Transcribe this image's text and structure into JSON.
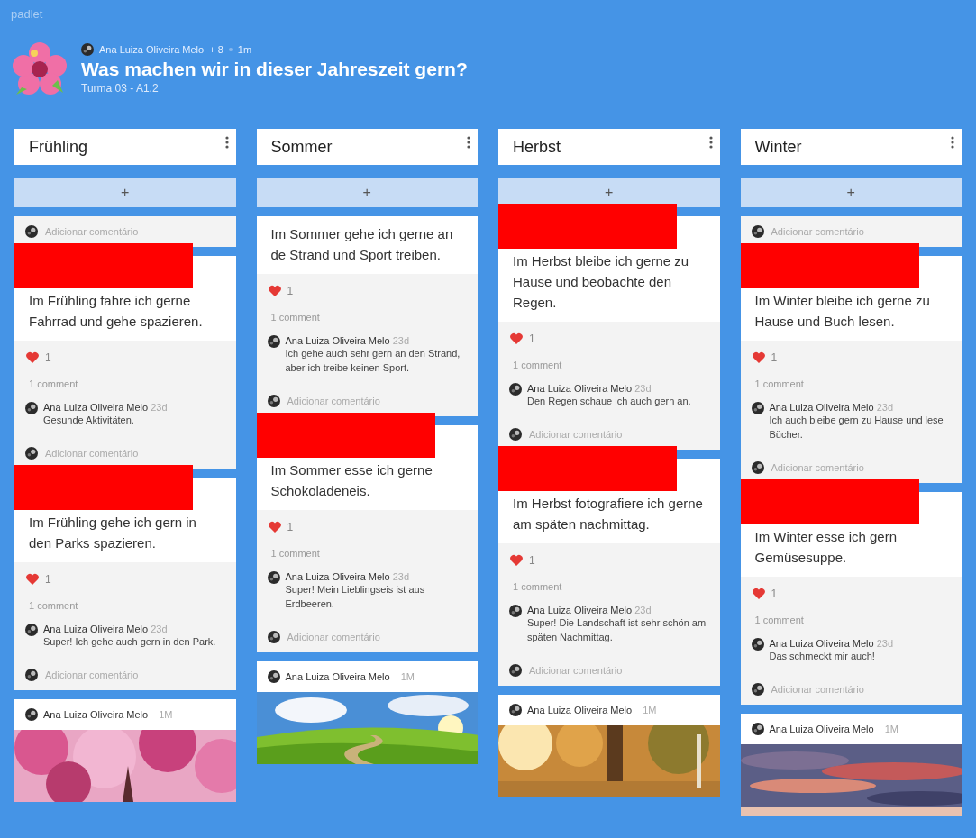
{
  "brand": "padlet",
  "header": {
    "author": "Ana Luiza Oliveira Melo",
    "contributors": "+ 8",
    "time": "1m",
    "title": "Was machen wir in dieser Jahreszeit gern?",
    "subtitle": "Turma 03 - A1.2"
  },
  "add_label": "+",
  "columns": [
    {
      "title": "Frühling",
      "posts": [
        {
          "kind": "tail",
          "add_comment": "Adicionar comentário"
        },
        {
          "kind": "post",
          "redacted": true,
          "text": "Im Frühling fahre ich gerne Fahrrad und gehe spazieren.",
          "likes": "1",
          "comment_count": "1 comment",
          "comments": [
            {
              "author": "Ana Luiza Oliveira Melo",
              "time": "23d",
              "text": "Gesunde Aktivitäten."
            }
          ],
          "add_comment": "Adicionar comentário"
        },
        {
          "kind": "post",
          "redacted": true,
          "text": "Im Frühling gehe ich gern in den Parks spazieren.",
          "likes": "1",
          "comment_count": "1 comment",
          "comments": [
            {
              "author": "Ana Luiza Oliveira Melo",
              "time": "23d",
              "text": "Super! Ich gehe auch gern in den Park."
            }
          ],
          "add_comment": "Adicionar comentário"
        },
        {
          "author": "Ana Luiza Oliveira Melo",
          "time": "1M"
        }
      ]
    },
    {
      "title": "Sommer",
      "posts": [
        {
          "kind": "post",
          "redacted": false,
          "text": "Im Sommer gehe ich gerne an de Strand und Sport treiben.",
          "likes": "1",
          "comment_count": "1 comment",
          "comments": [
            {
              "author": "Ana Luiza Oliveira Melo",
              "time": "23d",
              "text": "Ich gehe auch sehr gern an den Strand, aber ich treibe keinen Sport."
            }
          ],
          "add_comment": "Adicionar comentário"
        },
        {
          "kind": "post",
          "redacted": true,
          "text": "Im Sommer esse ich gerne Schokoladeneis.",
          "likes": "1",
          "comment_count": "1 comment",
          "comments": [
            {
              "author": "Ana Luiza Oliveira Melo",
              "time": "23d",
              "text": "Super! Mein Lieblingseis ist aus Erdbeeren."
            }
          ],
          "add_comment": "Adicionar comentário"
        },
        {
          "author": "Ana Luiza Oliveira Melo",
          "time": "1M"
        }
      ]
    },
    {
      "title": "Herbst",
      "posts": [
        {
          "kind": "post",
          "redacted": true,
          "text": "Im Herbst bleibe ich gerne zu Hause und beobachte den Regen.",
          "likes": "1",
          "comment_count": "1 comment",
          "comments": [
            {
              "author": "Ana Luiza Oliveira Melo",
              "time": "23d",
              "text": "Den Regen schaue ich auch gern an."
            }
          ],
          "add_comment": "Adicionar comentário"
        },
        {
          "kind": "post",
          "redacted": true,
          "text": "Im Herbst fotografiere ich gerne am späten nachmittag.",
          "likes": "1",
          "comment_count": "1 comment",
          "comments": [
            {
              "author": "Ana Luiza Oliveira Melo",
              "time": "23d",
              "text": "Super! Die Landschaft ist sehr schön am späten Nachmittag."
            }
          ],
          "add_comment": "Adicionar comentário"
        },
        {
          "author": "Ana Luiza Oliveira Melo",
          "time": "1M"
        }
      ]
    },
    {
      "title": "Winter",
      "posts": [
        {
          "kind": "tail",
          "add_comment": "Adicionar comentário"
        },
        {
          "kind": "post",
          "redacted": true,
          "text": "Im Winter bleibe ich gerne zu Hause und Buch lesen.",
          "likes": "1",
          "comment_count": "1 comment",
          "comments": [
            {
              "author": "Ana Luiza Oliveira Melo",
              "time": "23d",
              "text": "Ich auch bleibe gern zu Hause und lese Bücher."
            }
          ],
          "add_comment": "Adicionar comentário"
        },
        {
          "kind": "post",
          "redacted": true,
          "text": "Im Winter esse ich gern Gemüsesuppe.",
          "likes": "1",
          "comment_count": "1 comment",
          "comments": [
            {
              "author": "Ana Luiza Oliveira Melo",
              "time": "23d",
              "text": "Das schmeckt mir auch!"
            }
          ],
          "add_comment": "Adicionar comentário"
        },
        {
          "author": "Ana Luiza Oliveira Melo",
          "time": "1M"
        }
      ]
    }
  ]
}
